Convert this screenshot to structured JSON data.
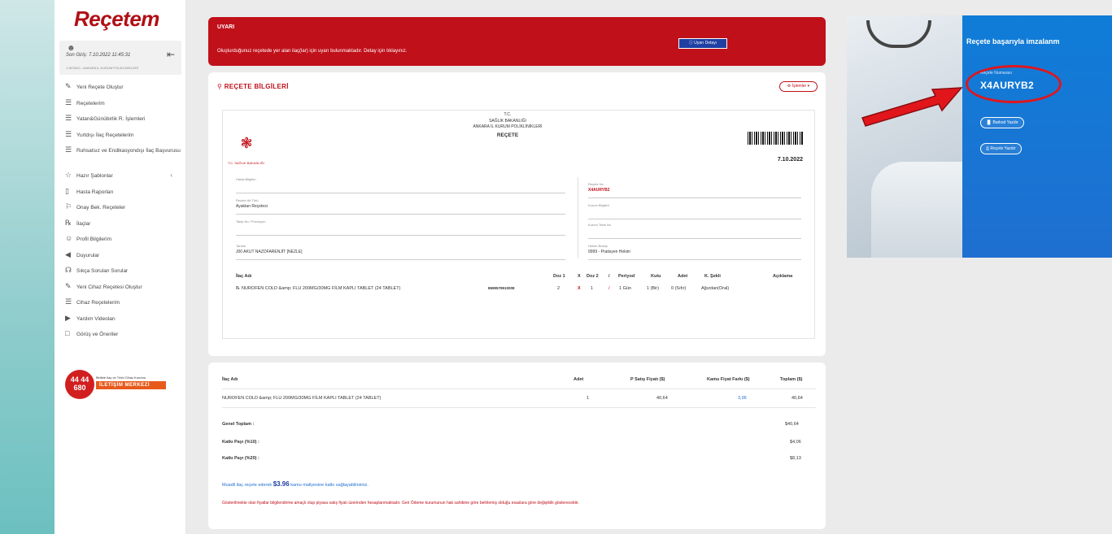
{
  "app": {
    "logo": "Reçetem"
  },
  "user": {
    "user_icon": "user-icon",
    "last_login": "Son Giriş: 7.10.2022 11:45:31",
    "detail": "1 NESNO - ANKARA İL KURUM POLİKLİNİKLERİ",
    "logout_icon": "logout-icon"
  },
  "sidebar": {
    "items": [
      {
        "label": "Yeni Reçete Oluştur",
        "icon": "edit-icon"
      },
      {
        "label": "Reçetelerim",
        "icon": "list-icon"
      },
      {
        "label": "Yatan&Günübirlik R. İşlemleri",
        "icon": "list-icon"
      },
      {
        "label": "Yurtdışı İlaç Reçetelerim",
        "icon": "list-icon"
      },
      {
        "label": "Ruhsatsız ve Endikasyondışı İlaç Başvurusu",
        "icon": "list-icon"
      },
      {
        "label": "Hazır Şablonlar",
        "icon": "star-icon"
      },
      {
        "label": "Hasta Raporları",
        "icon": "document-icon"
      },
      {
        "label": "Onay Bek. Reçeteler",
        "icon": "flag-icon"
      },
      {
        "label": "İlaçlar",
        "icon": "pill-icon"
      },
      {
        "label": "Profil Bilgilerim",
        "icon": "profile-icon"
      },
      {
        "label": "Duyurular",
        "icon": "megaphone-icon"
      },
      {
        "label": "Sıkça Sorulan Sorular",
        "icon": "headset-icon"
      },
      {
        "label": "Yeni Cihaz Reçetesi Oluştur",
        "icon": "edit-icon"
      },
      {
        "label": "Cihaz Reçetelerim",
        "icon": "list-icon"
      },
      {
        "label": "Yardım Videoları",
        "icon": "video-icon"
      },
      {
        "label": "Görüş ve Öneriler",
        "icon": "chat-icon"
      }
    ],
    "badge": {
      "top": "44 44",
      "bottom": "680",
      "caption": "Birlikte İlaç ve Tıbbi Cihaz Kurumu",
      "bar": "İLETİŞİM MERKEZİ"
    }
  },
  "warning": {
    "title": "UYARI",
    "text": "Oluşturduğunuz reçetede yer alan ilaç(lar) için uyarı bulunmaktadır. Detay için tıklayınız.",
    "button": "Uyarı Detayı"
  },
  "prescription": {
    "title": "REÇETE BİLGİLERİ",
    "ops_button": "İşlemler",
    "header": {
      "tc": "T.C.",
      "ministry": "SAĞLIK BAKANLIĞI",
      "institution": "ANKARA İL KURUM POLİKLİNİKLERİ",
      "doc_title": "REÇETE",
      "emblem_label": "T.C. SAĞLIK BAKANLIĞI",
      "date": "7.10.2022"
    },
    "fields_left": [
      {
        "label": "Hasta Bilgileri",
        "value": ""
      },
      {
        "label": "Reçete Alt Türü",
        "value": "Ayaktan Reçetesi"
      },
      {
        "label": "Takip No / Provizyon",
        "value": ""
      },
      {
        "label": "Tanılar",
        "value": "J00 AKUT NAZOFARENJİT [NEZLE]"
      }
    ],
    "fields_right": [
      {
        "label": "Reçete No",
        "value": "X4AURYB2"
      },
      {
        "label": "Kurum Bilgileri",
        "value": ""
      },
      {
        "label": "Kurum Tesis No",
        "value": ""
      },
      {
        "label": "Hekim Branşı",
        "value": "9999 - Pratisyen Hekim"
      }
    ],
    "table_headers": {
      "drug": "İlaç Adı",
      "dose1": "Doz 1",
      "x": "X",
      "dose2": "Doz 2",
      "slash": "/",
      "period": "Periyod",
      "box": "Kutu",
      "qty": "Adet",
      "form": "K. Şekli",
      "desc": "Açıklama"
    },
    "row": {
      "drug": "NUROFEN COLD &amp; FLU 200MG/30MG FİLM KAPLI TABLET (24 TABLET)",
      "barcode": "8699579910008",
      "dose1": "2",
      "x": "X",
      "dose2": "1",
      "slash": "/",
      "period": "1 Gün",
      "box": "1 (Bir)",
      "qty": "0 (Sıfır)",
      "form": "Ağızdan(Oral)"
    }
  },
  "pricing": {
    "headers": {
      "drug": "İlaç Adı",
      "qty": "Adet",
      "price": "P Satış Fiyatı ($)",
      "diff": "Kamu Fiyat Farkı ($)",
      "total": "Toplam ($)"
    },
    "row": {
      "drug": "NUROFEN COLD &amp; FLU 200MG/30MG FİLM KAPLI TABLET (24 TABLET)",
      "qty": "1",
      "price": "40,64",
      "diff": "3,96",
      "total": "40,64"
    },
    "general_total_label": "Genel Toplam :",
    "general_total": "$40,64",
    "share10_label": "Katkı Payı (%10) :",
    "share10": "$4,06",
    "share20_label": "Katkı Payı (%20) :",
    "share20": "$8,13",
    "savings_prefix": "Muadil ilaç reçete ederek",
    "savings_amount": "$3.96",
    "savings_suffix": "kamu maliyesine katkı sağlayabilirsiniz.",
    "note": "Gösterilmekte olan fiyatlar bilgilendirme amaçlı olup piyasa satış fiyatı üzerinden hesaplanmaktadır. Geri Ödeme kurumunun hak sahibine göre belirlemiş olduğu esaslara göre değişiklik gösterecektir."
  },
  "success": {
    "title": "Reçete başarıyla imzalanm",
    "number_label": "Reçete Numarası",
    "number": "X4AURYB2",
    "barcode_button": "Barkod Yazdır",
    "print_button": "Reçete Yazdır"
  },
  "colors": {
    "brand_red": "#c0101a",
    "brand_blue": "#1f6fd0",
    "annotation_red": "#e0161b"
  }
}
